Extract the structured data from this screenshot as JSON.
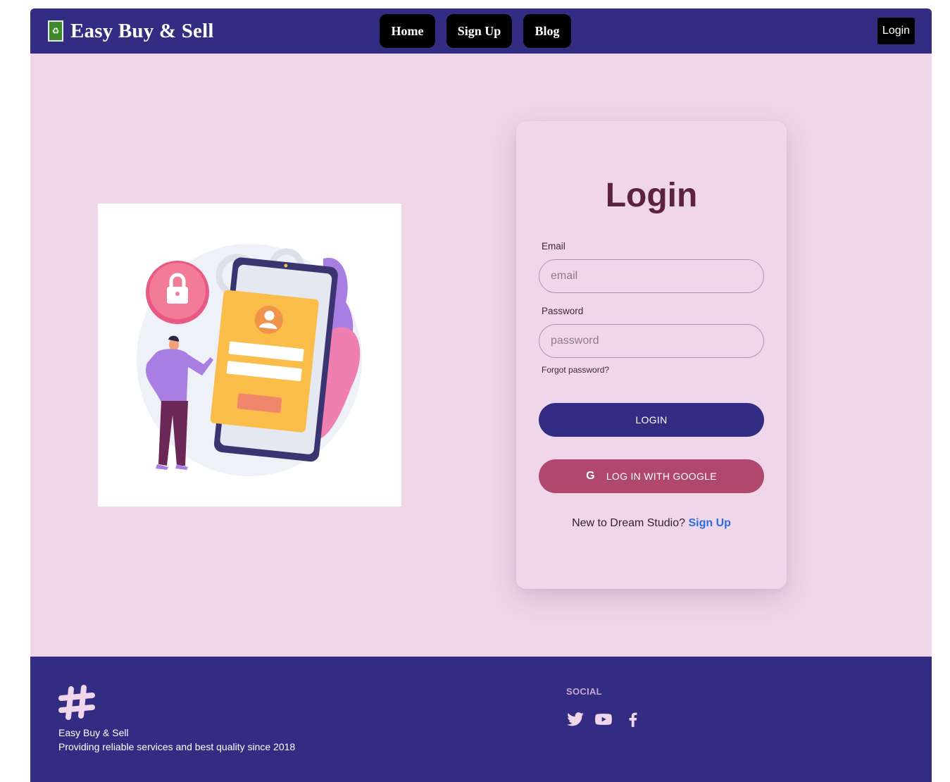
{
  "navbar": {
    "brand_name": "Easy Buy & Sell",
    "logo_icon": "recycle-icon",
    "links": [
      {
        "label": "Home"
      },
      {
        "label": "Sign Up"
      },
      {
        "label": "Blog"
      }
    ],
    "login_label": "Login"
  },
  "illustration": {
    "description_icon": "login-phone-illustration"
  },
  "login_card": {
    "title": "Login",
    "email_label": "Email",
    "email_placeholder": "email",
    "password_label": "Password",
    "password_placeholder": "password",
    "forgot_label": "Forgot password?",
    "login_button": "LOGIN",
    "google_button": "LOG IN WITH GOOGLE",
    "google_icon": "google-icon",
    "signup_prompt": "New to Dream Studio?",
    "signup_link": "Sign Up"
  },
  "footer": {
    "logo_icon": "hashtag-logo-icon",
    "company": "Easy Buy & Sell",
    "tagline": "Providing reliable services and best quality since 2018",
    "social_title": "SOCIAL",
    "social_icons": [
      "twitter-icon",
      "youtube-icon",
      "facebook-icon"
    ]
  },
  "colors": {
    "navbar_bg": "#322c82",
    "page_bg": "#f0d6ea",
    "title_color": "#5c2340",
    "login_button": "#322c82",
    "google_button": "#b0476d",
    "link_color": "#2a6fe0"
  }
}
